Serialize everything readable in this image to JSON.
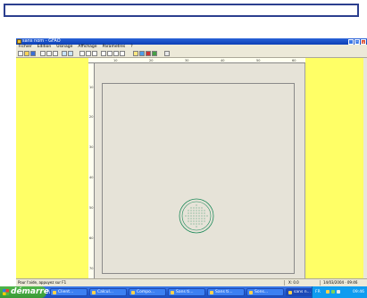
{
  "window": {
    "title": "sans nom - GFAO",
    "menu": [
      "Fichier",
      "Edition",
      "Usinage",
      "Affichage",
      "Parametres",
      "?"
    ],
    "controls": {
      "minimize": "_",
      "maximize": "□",
      "close": "✕"
    }
  },
  "toolbar": {
    "icons": [
      "new-icon",
      "open-icon",
      "save-icon",
      "cut-icon",
      "copy-icon",
      "paste-icon",
      "undo-icon",
      "redo-icon",
      "zoom-in-icon",
      "zoom-out-icon",
      "zoom-window-icon",
      "zoom-all-icon",
      "pan-icon",
      "grid-icon",
      "snap-icon",
      "draw-icon",
      "print-icon",
      "measure-icon",
      "calc-icon",
      "help-icon"
    ]
  },
  "rulers": {
    "horizontal": [
      "10",
      "20",
      "30",
      "40",
      "50",
      "60"
    ],
    "vertical": [
      "10",
      "20",
      "30",
      "40",
      "50",
      "60",
      "70"
    ]
  },
  "statusbar": {
    "help": "Pour l'aide, appuyez sur F1",
    "coords": "X: 0.0",
    "datetime": "14/03/2004 · 09:46"
  },
  "taskbar": {
    "start_label": "démarrer",
    "tasks": [
      {
        "label": "Client..."
      },
      {
        "label": "Calcul..."
      },
      {
        "label": "Compo..."
      },
      {
        "label": "Sans ti..."
      },
      {
        "label": "Sans ti..."
      },
      {
        "label": "Sons..."
      },
      {
        "label": "sans n...",
        "active": true
      }
    ],
    "tray_lang": "FR",
    "clock": "09:46"
  },
  "colors": {
    "workspace": "#ffff66",
    "sheet": "#e6e3d8",
    "titlebar": "#0b3fb6",
    "component": "#1e8a5a"
  }
}
